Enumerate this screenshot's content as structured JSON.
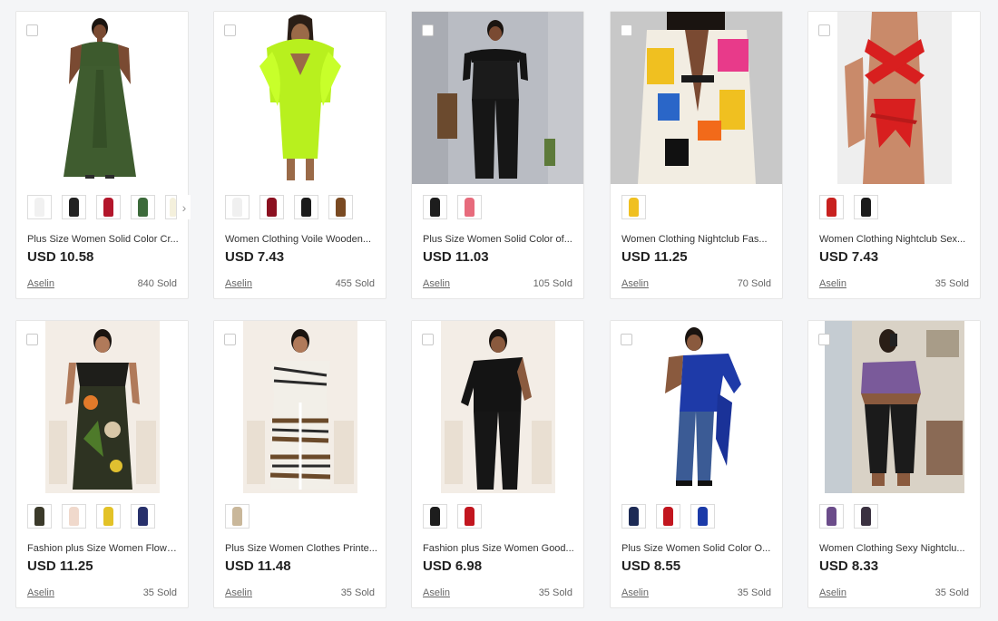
{
  "products": [
    {
      "title": "Plus Size Women Solid Color Cr...",
      "price": "USD 10.58",
      "shop": "Aselin",
      "sold": "840 Sold",
      "image": "model-green-maxi-dress",
      "bg": "#ffffff",
      "colors": [
        "#f1f1f1",
        "#222222",
        "#b3162b",
        "#3c6a3a",
        "#f4f0dc"
      ],
      "has_more": true
    },
    {
      "title": "Women Clothing Voile Wooden...",
      "price": "USD 7.43",
      "shop": "Aselin",
      "sold": "455 Sold",
      "image": "model-neon-ruffle-dress",
      "bg": "#ffffff",
      "colors": [
        "#f0f0f0",
        "#8b1020",
        "#1b1b1b",
        "#7a4a22"
      ],
      "has_more": false
    },
    {
      "title": "Plus Size Women Solid Color of...",
      "price": "USD 11.03",
      "shop": "Aselin",
      "sold": "105 Sold",
      "image": "model-black-jumpsuit",
      "bg": "#b9bcc3",
      "colors": [
        "#1d1d1d",
        "#e76b7c"
      ],
      "has_more": false
    },
    {
      "title": "Women Clothing Nightclub Fas...",
      "price": "USD 11.25",
      "shop": "Aselin",
      "sold": "70 Sold",
      "image": "model-colorblock-blazer",
      "bg": "#c8c8c8",
      "colors": [
        "#f0c020"
      ],
      "has_more": false
    },
    {
      "title": "Women Clothing Nightclub Sex...",
      "price": "USD 7.43",
      "shop": "Aselin",
      "sold": "35 Sold",
      "image": "model-red-wrap-bodysuit",
      "bg": "#eeeeee",
      "colors": [
        "#c8211f",
        "#1b1b1b"
      ],
      "has_more": false
    },
    {
      "title": "Fashion plus Size Women Flowe...",
      "price": "USD 11.25",
      "shop": "Aselin",
      "sold": "35 Sold",
      "image": "model-floral-tube-set",
      "bg": "#f3ede6",
      "colors": [
        "#3b3a2a",
        "#f0d9cc",
        "#e3c227",
        "#27306b"
      ],
      "has_more": false
    },
    {
      "title": "Plus Size Women Clothes Printe...",
      "price": "USD 11.48",
      "shop": "Aselin",
      "sold": "35 Sold",
      "image": "model-printed-pants-set",
      "bg": "#f3ede6",
      "colors": [
        "#c9b79a"
      ],
      "has_more": false
    },
    {
      "title": "Fashion plus Size Women Good...",
      "price": "USD 6.98",
      "shop": "Aselin",
      "sold": "35 Sold",
      "image": "model-black-one-shoulder-set",
      "bg": "#f3ede6",
      "colors": [
        "#1d1d1d",
        "#c2161f"
      ],
      "has_more": false
    },
    {
      "title": "Plus Size Women Solid Color O...",
      "price": "USD 8.55",
      "shop": "Aselin",
      "sold": "35 Sold",
      "image": "model-blue-one-shoulder-top",
      "bg": "#ffffff",
      "colors": [
        "#1c2a55",
        "#c2161f",
        "#1b3aa8"
      ],
      "has_more": false
    },
    {
      "title": "Women Clothing Sexy Nightclu...",
      "price": "USD 8.33",
      "shop": "Aselin",
      "sold": "35 Sold",
      "image": "model-purple-crop-joggers",
      "bg": "#d9d2c6",
      "colors": [
        "#6b4c8a",
        "#3a3140"
      ],
      "has_more": false
    }
  ]
}
